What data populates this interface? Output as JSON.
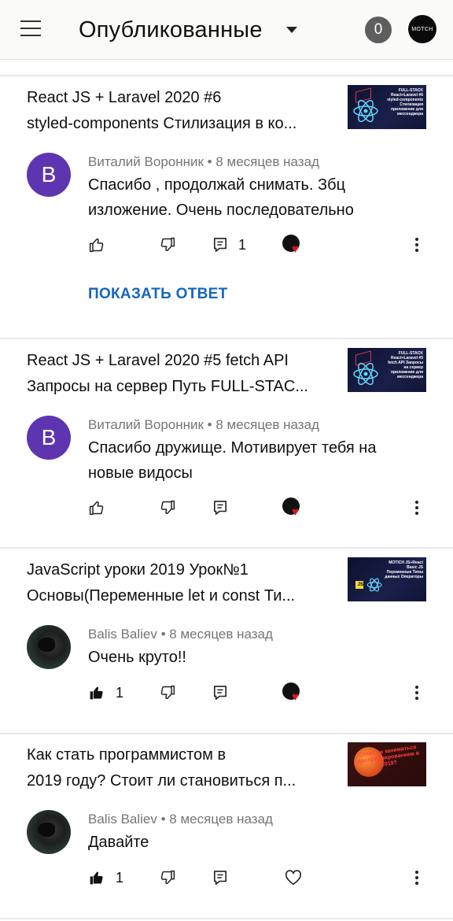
{
  "header": {
    "filter_label": "Опубликованные",
    "notification_count": "0",
    "channel_avatar_text": "MOTCH"
  },
  "cards": [
    {
      "video_title_line1": "React JS + Laravel 2020 #6",
      "video_title_line2": "styled-components Стилизация в ко...",
      "thumbnail_text": "FULL-STACK React+Laravel #6 styled-components Стилизация приложение для мессенджера",
      "author_initial": "В",
      "author": "Виталий Воронник",
      "time": "8 месяцев назад",
      "comment_line1": "Спасибо , продолжай снимать. Збц",
      "comment_line2": "изложение. Очень последовательно",
      "like_count": "",
      "reply_count": "1",
      "show_reply_label": "ПОКАЗАТЬ ОТВЕТ",
      "liked": false,
      "creator_heart": true
    },
    {
      "video_title_line1": "React JS + Laravel 2020 #5 fetch API",
      "video_title_line2": "Запросы на сервер Путь FULL-STAC...",
      "thumbnail_text": "FULL-STACK React+Laravel #5 fetch API Запросы на сервер приложение для мессенджера",
      "author_initial": "В",
      "author": "Виталий Воронник",
      "time": "8 месяцев назад",
      "comment_line1": "Спасибо дружище. Мотивирует тебя на",
      "comment_line2": "новые видосы",
      "like_count": "",
      "reply_count": "",
      "liked": false,
      "creator_heart": true
    },
    {
      "video_title_line1": "JavaScript уроки 2019 Урок№1",
      "video_title_line2": "Основы(Переменные let и const Ти...",
      "thumbnail_text": "MOTICH JS+React Basic JS Переменные Типы данных Операторы",
      "author": "Balis Baliev",
      "time": "8 месяцев назад",
      "comment_line1": "Очень круто!!",
      "comment_line2": "",
      "like_count": "1",
      "reply_count": "",
      "liked": true,
      "creator_heart": true
    },
    {
      "video_title_line1": "Как стать программистом в",
      "video_title_line2": "2019 году? Стоит ли становиться п...",
      "thumbnail_text": "Стоит ли заниматься программированием в 2019?",
      "author": "Balis Baliev",
      "time": "8 месяцев назад",
      "comment_line1": "Давайте",
      "comment_line2": "",
      "like_count": "1",
      "reply_count": "",
      "liked": true,
      "creator_heart": false
    }
  ],
  "meta_separator": "•",
  "colors": {
    "link_blue": "#1565c0",
    "avatar_purple": "#5e35b1",
    "heart_red": "#e1141e",
    "meta_gray": "#757575"
  }
}
